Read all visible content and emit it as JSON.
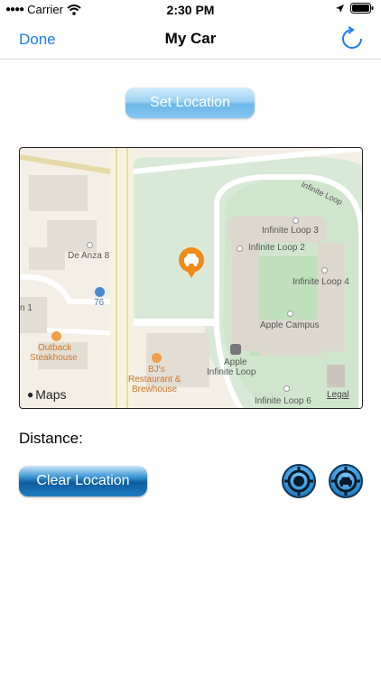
{
  "status_bar": {
    "carrier": "Carrier",
    "time": "2:30 PM"
  },
  "nav": {
    "done_label": "Done",
    "title": "My Car",
    "refresh_icon": "refresh-icon"
  },
  "buttons": {
    "set_location": "Set Location",
    "clear_location": "Clear Location"
  },
  "distance_label": "Distance:",
  "map": {
    "labels": {
      "infinite_loop_road": "Infinite Loop",
      "il3": "Infinite Loop 3",
      "il2": "Infinite Loop 2",
      "il4": "Infinite Loop 4",
      "de_anza": "De Anza 8",
      "route": "76",
      "n1": "n 1",
      "apple_campus": "Apple Campus",
      "outback_1": "Outback",
      "outback_2": "Steakhouse",
      "bjs_1": "BJ's",
      "bjs_2": "Restaurant &",
      "bjs_3": "Brewhouse",
      "apple_il_1": "Apple",
      "apple_il_2": "Infinite Loop",
      "il6": "Infinite Loop 6",
      "maps_brand": "Maps",
      "legal": "Legal"
    }
  },
  "icons": {
    "locate_user": "crosshair-target-icon",
    "locate_car": "car-target-icon"
  },
  "colors": {
    "accent": "#1a7cf5",
    "pin": "#f08a1c"
  }
}
